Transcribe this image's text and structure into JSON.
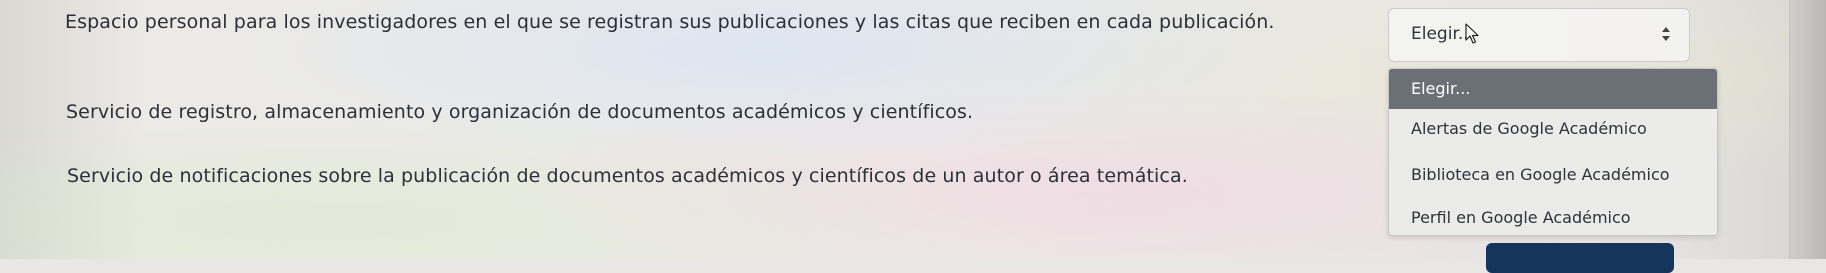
{
  "rows": [
    {
      "description": "Espacio personal para los investigadores en el que se registran sus publicaciones y las citas que reciben en cada publicación."
    },
    {
      "description": "Servicio de registro, almacenamiento y organización de documentos académicos y científicos."
    },
    {
      "description": "Servicio de notificaciones sobre la publicación de documentos académicos y científicos de un autor o área temática."
    }
  ],
  "select": {
    "value": "Elegir...",
    "icon": "updown-icon"
  },
  "dropdown": {
    "options": [
      "Elegir...",
      "Alertas de Google Académico",
      "Biblioteca en Google Académico",
      "Perfil en Google Académico"
    ],
    "highlighted_index": 0
  },
  "colors": {
    "highlight": "#6b7077",
    "button": "#16355c",
    "text": "#2d3039"
  }
}
